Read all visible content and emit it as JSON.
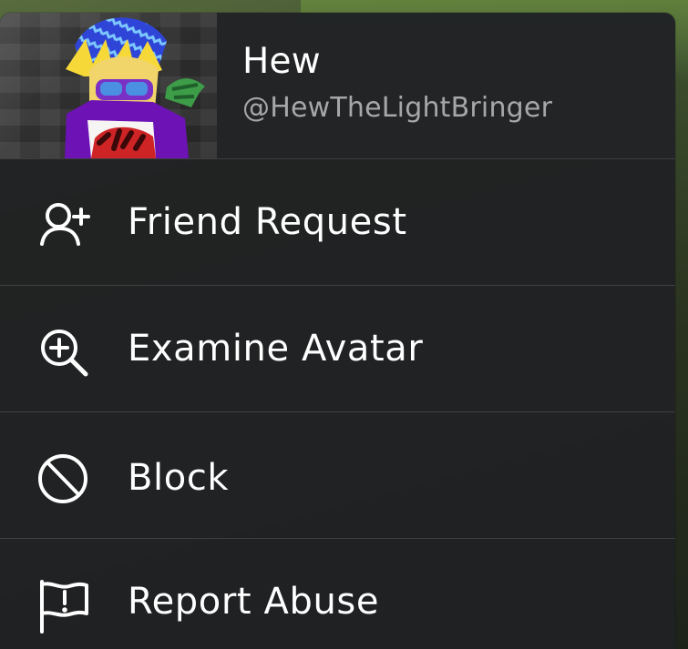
{
  "profile": {
    "display_name": "Hew",
    "username": "@HewTheLightBringer",
    "avatar_icon": "player-avatar"
  },
  "menu": {
    "items": [
      {
        "label": "Friend Request",
        "icon": "friend-request-icon"
      },
      {
        "label": "Examine Avatar",
        "icon": "examine-avatar-icon"
      },
      {
        "label": "Block",
        "icon": "block-icon"
      },
      {
        "label": "Report Abuse",
        "icon": "report-abuse-icon"
      }
    ]
  },
  "colors": {
    "panel": "#202123",
    "text": "#ffffff",
    "secondary_text": "#a7a7a7",
    "divider": "#4a4a4a"
  }
}
